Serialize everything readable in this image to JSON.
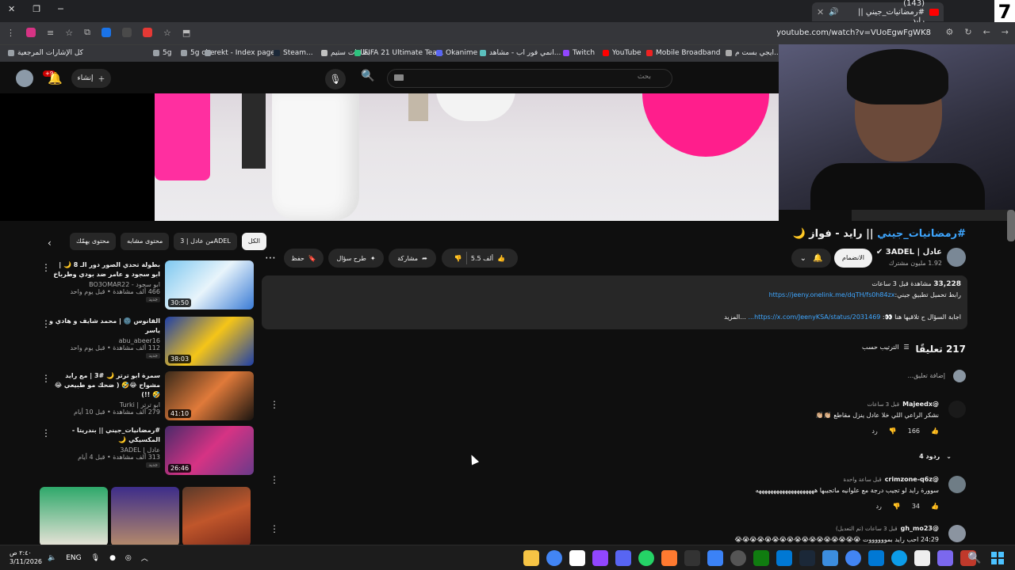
{
  "browser": {
    "tab_title": "(143) #رمضانيات_جيني || رايد",
    "url": "youtube.com/watch?v=VUoEgwFgWK8",
    "corner_badge": "7",
    "bookmarks": [
      {
        "label": "كل الإشارات المرجعية",
        "color": "#9aa0a6"
      },
      {
        "label": "5g",
        "color": "#9aa0a6"
      },
      {
        "label": "5g cbe",
        "color": "#9aa0a6"
      },
      {
        "label": "rekt - Index page",
        "color": "#9aa0a6"
      },
      {
        "label": "Steam...",
        "color": "#1b2838"
      },
      {
        "label": "بطاقات ستيم",
        "color": "#c0c0c0"
      },
      {
        "label": "FIFA 21 Ultimate Tea...",
        "color": "#2ec27e"
      },
      {
        "label": "Okanime",
        "color": "#5865f2"
      },
      {
        "label": "انمي فور اب - مشاهد...",
        "color": "#5bc0be"
      },
      {
        "label": "Twitch",
        "color": "#9146ff"
      },
      {
        "label": "YouTube",
        "color": "#ff0000"
      },
      {
        "label": "Mobile Broadband",
        "color": "#e22"
      },
      {
        "label": "ايجي بست م...",
        "color": "#aaa"
      }
    ]
  },
  "youtube": {
    "search_placeholder": "بحث",
    "create_label": "إنشاء",
    "notif_count": "+9",
    "video_title_tag": "#رمضانيات_جيني",
    "video_title_rest": " || رايد - فواز 🌙",
    "channel_name": "عادل | 3ADEL",
    "channel_subs": "1.92 مليون مشترك",
    "joined_label": "الانضمام",
    "like_count": "5.5 ألف",
    "share_label": "مشاركة",
    "ask_label": "طرح سؤال",
    "save_label": "حفظ",
    "description": {
      "views_line_bold": "33,228",
      "views_line": " مشاهدة قبل 3 ساعات",
      "line1_text": "رابط تحميل تطبيق جيني:",
      "line1_link": "https://jeeny.onelink.me/dqTH/fs0h84zx",
      "line2_text": "اجابة السؤال ح تلاقيها هنا 👀: ",
      "line2_link": "https://x.com/JeenyKSA/status/2031469...",
      "more": "...المزيد"
    },
    "comments_count": "217 تعليقًا",
    "sort_label": "الترتيب حسب",
    "add_comment": "إضافة تعليق...",
    "comments": [
      {
        "author": "@Majeedx",
        "time": "قبل 3 ساعات",
        "text": "نشكر الراعي اللي خلا عادل ينزل مقاطع 👏🏼👏🏼",
        "likes": "166",
        "reply": "رد",
        "avatar": "#1a1a1a"
      },
      {
        "author": "@crimzone-q6z",
        "time": "قبل ساعة واحدة",
        "text": "سوورة رايد لو تجيب درجة مع علوانيه ماتجيبها ههههههههههههههههههههه",
        "likes": "34",
        "reply": "رد",
        "avatar": "#6f7d86"
      },
      {
        "author": "@gh_mo23",
        "time": "قبل 3 ساعات (تم التعديل)",
        "text": "24:29 احب رايد بمووووووت 😭😭😭😭😭😭😭😭😭😭😭😭😭😭😭😭😭",
        "likes": "",
        "reply": "",
        "avatar": "#8b94a0"
      }
    ],
    "replies_label": "4 ردود",
    "chips": [
      "الكل",
      "من عادل | 3ADEL",
      "محتوى مشابه",
      "محتوى يهمّك"
    ],
    "recommendations": [
      {
        "title": "بطولة تحدي الصور دور الـ 8 🌙 | ابو سجود و عامر ضد بودي وطرباخ",
        "channel": "ابو سجود - BO3OMAR22",
        "meta": "466 ألف مشاهدة • قبل يوم واحد",
        "badge": "جديد",
        "duration": "30:50"
      },
      {
        "title": "القانوس 🌚 | محمد شايف و هادي و ياسر",
        "channel": "abu_abeer16",
        "meta": "112 ألف مشاهدة • قبل يوم واحد",
        "badge": "جديد",
        "duration": "38:03"
      },
      {
        "title": "سمرة ابو ترتر 🌙 #3 | مع رايد مشواح 😂🤣 ( ضحك مو طبيعي 😂🤣 !!)",
        "channel": "ابو ترتر | Turki",
        "meta": "279 ألف مشاهدة • قبل 10 أيام",
        "badge": "",
        "duration": "41:10"
      },
      {
        "title": "#رمضانيات_جيني || بندريتا - المكسيكي 🌙",
        "channel": "عادل | 3ADEL",
        "meta": "313 ألف مشاهدة • قبل 4 أيام",
        "badge": "جديد",
        "duration": "26:46"
      }
    ]
  },
  "taskbar": {
    "time": "٢:٤٠ ص",
    "date": "3/11/2026",
    "lang": "ENG"
  }
}
